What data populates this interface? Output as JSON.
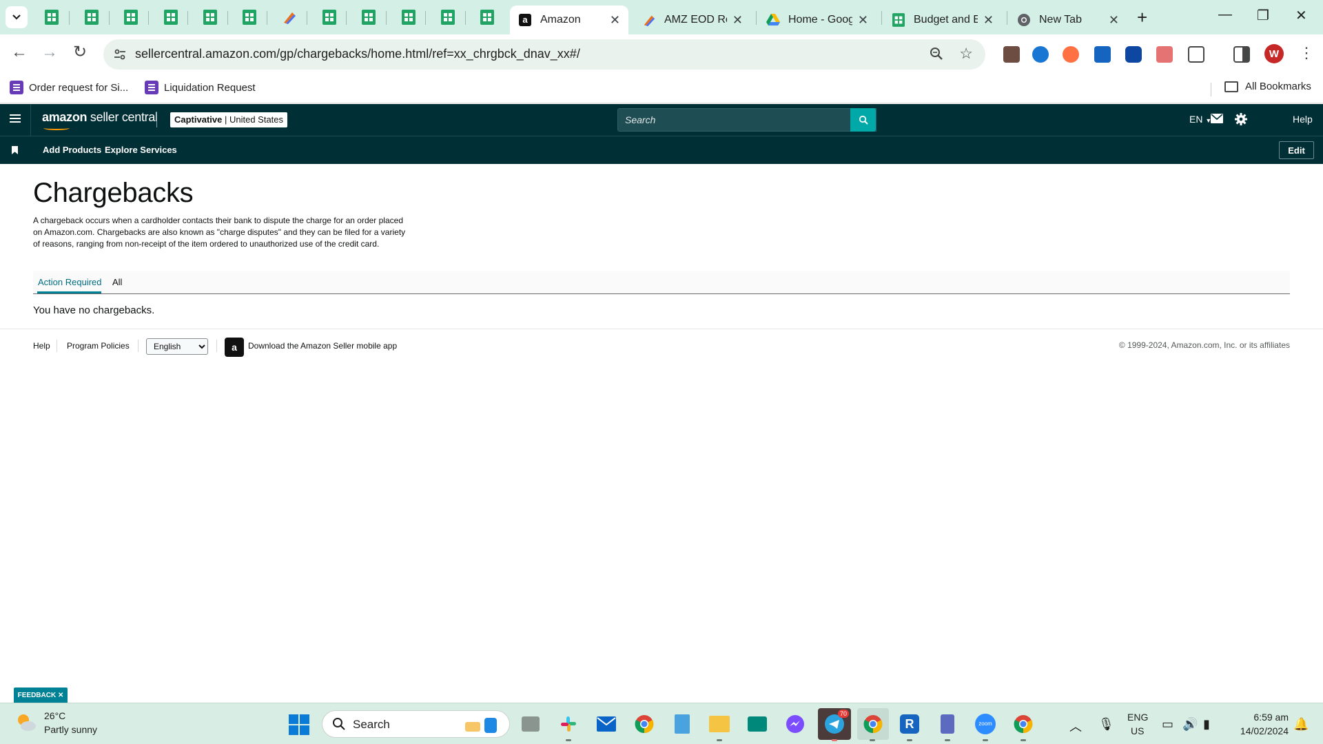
{
  "browser": {
    "tabs": [
      {
        "title": "Amazon",
        "active": true
      },
      {
        "title": "AMZ EOD Rep",
        "active": false
      },
      {
        "title": "Home - Goog",
        "active": false
      },
      {
        "title": "Budget and E",
        "active": false
      },
      {
        "title": "New Tab",
        "active": false
      }
    ],
    "url": "sellercentral.amazon.com/gp/chargebacks/home.html/ref=xx_chrgbck_dnav_xx#/",
    "profile_initial": "W",
    "bookmarks": [
      {
        "label": "Order request for Si..."
      },
      {
        "label": "Liquidation Request"
      }
    ],
    "all_bookmarks_label": "All Bookmarks",
    "colors": {
      "tabstrip": "#d4efe5",
      "omnibox": "#eaf2ee"
    }
  },
  "seller_central": {
    "logo_bold": "amazon",
    "logo_rest": " seller central",
    "account_name": "Captivative",
    "account_region": "United States",
    "search_placeholder": "Search",
    "language": "EN",
    "help_label": "Help",
    "subnav": {
      "add_products": "Add Products",
      "explore_services": "Explore Services",
      "edit": "Edit"
    },
    "colors": {
      "header": "#002f36",
      "accent": "#008296",
      "search_button": "#00a8a8"
    }
  },
  "page": {
    "title": "Chargebacks",
    "description": "A chargeback occurs when a cardholder contacts their bank to dispute the charge for an order placed on Amazon.com. Chargebacks are also known as \"charge disputes\" and they can be filed for a variety of reasons, ranging from non-receipt of the item ordered to unauthorized use of the credit card.",
    "tabs": [
      {
        "label": "Action Required",
        "active": true
      },
      {
        "label": "All",
        "active": false
      }
    ],
    "empty_message": "You have no chargebacks."
  },
  "footer": {
    "help": "Help",
    "program_policies": "Program Policies",
    "language_selected": "English",
    "app_link": "Download the Amazon Seller mobile app",
    "copyright": "© 1999-2024, Amazon.com, Inc. or its affiliates"
  },
  "feedback_label": "FEEDBACK",
  "taskbar": {
    "weather_temp": "26°C",
    "weather_desc": "Partly sunny",
    "search_label": "Search",
    "telegram_badge": "70",
    "lang_line1": "ENG",
    "lang_line2": "US",
    "time": "6:59 am",
    "date": "14/02/2024"
  }
}
